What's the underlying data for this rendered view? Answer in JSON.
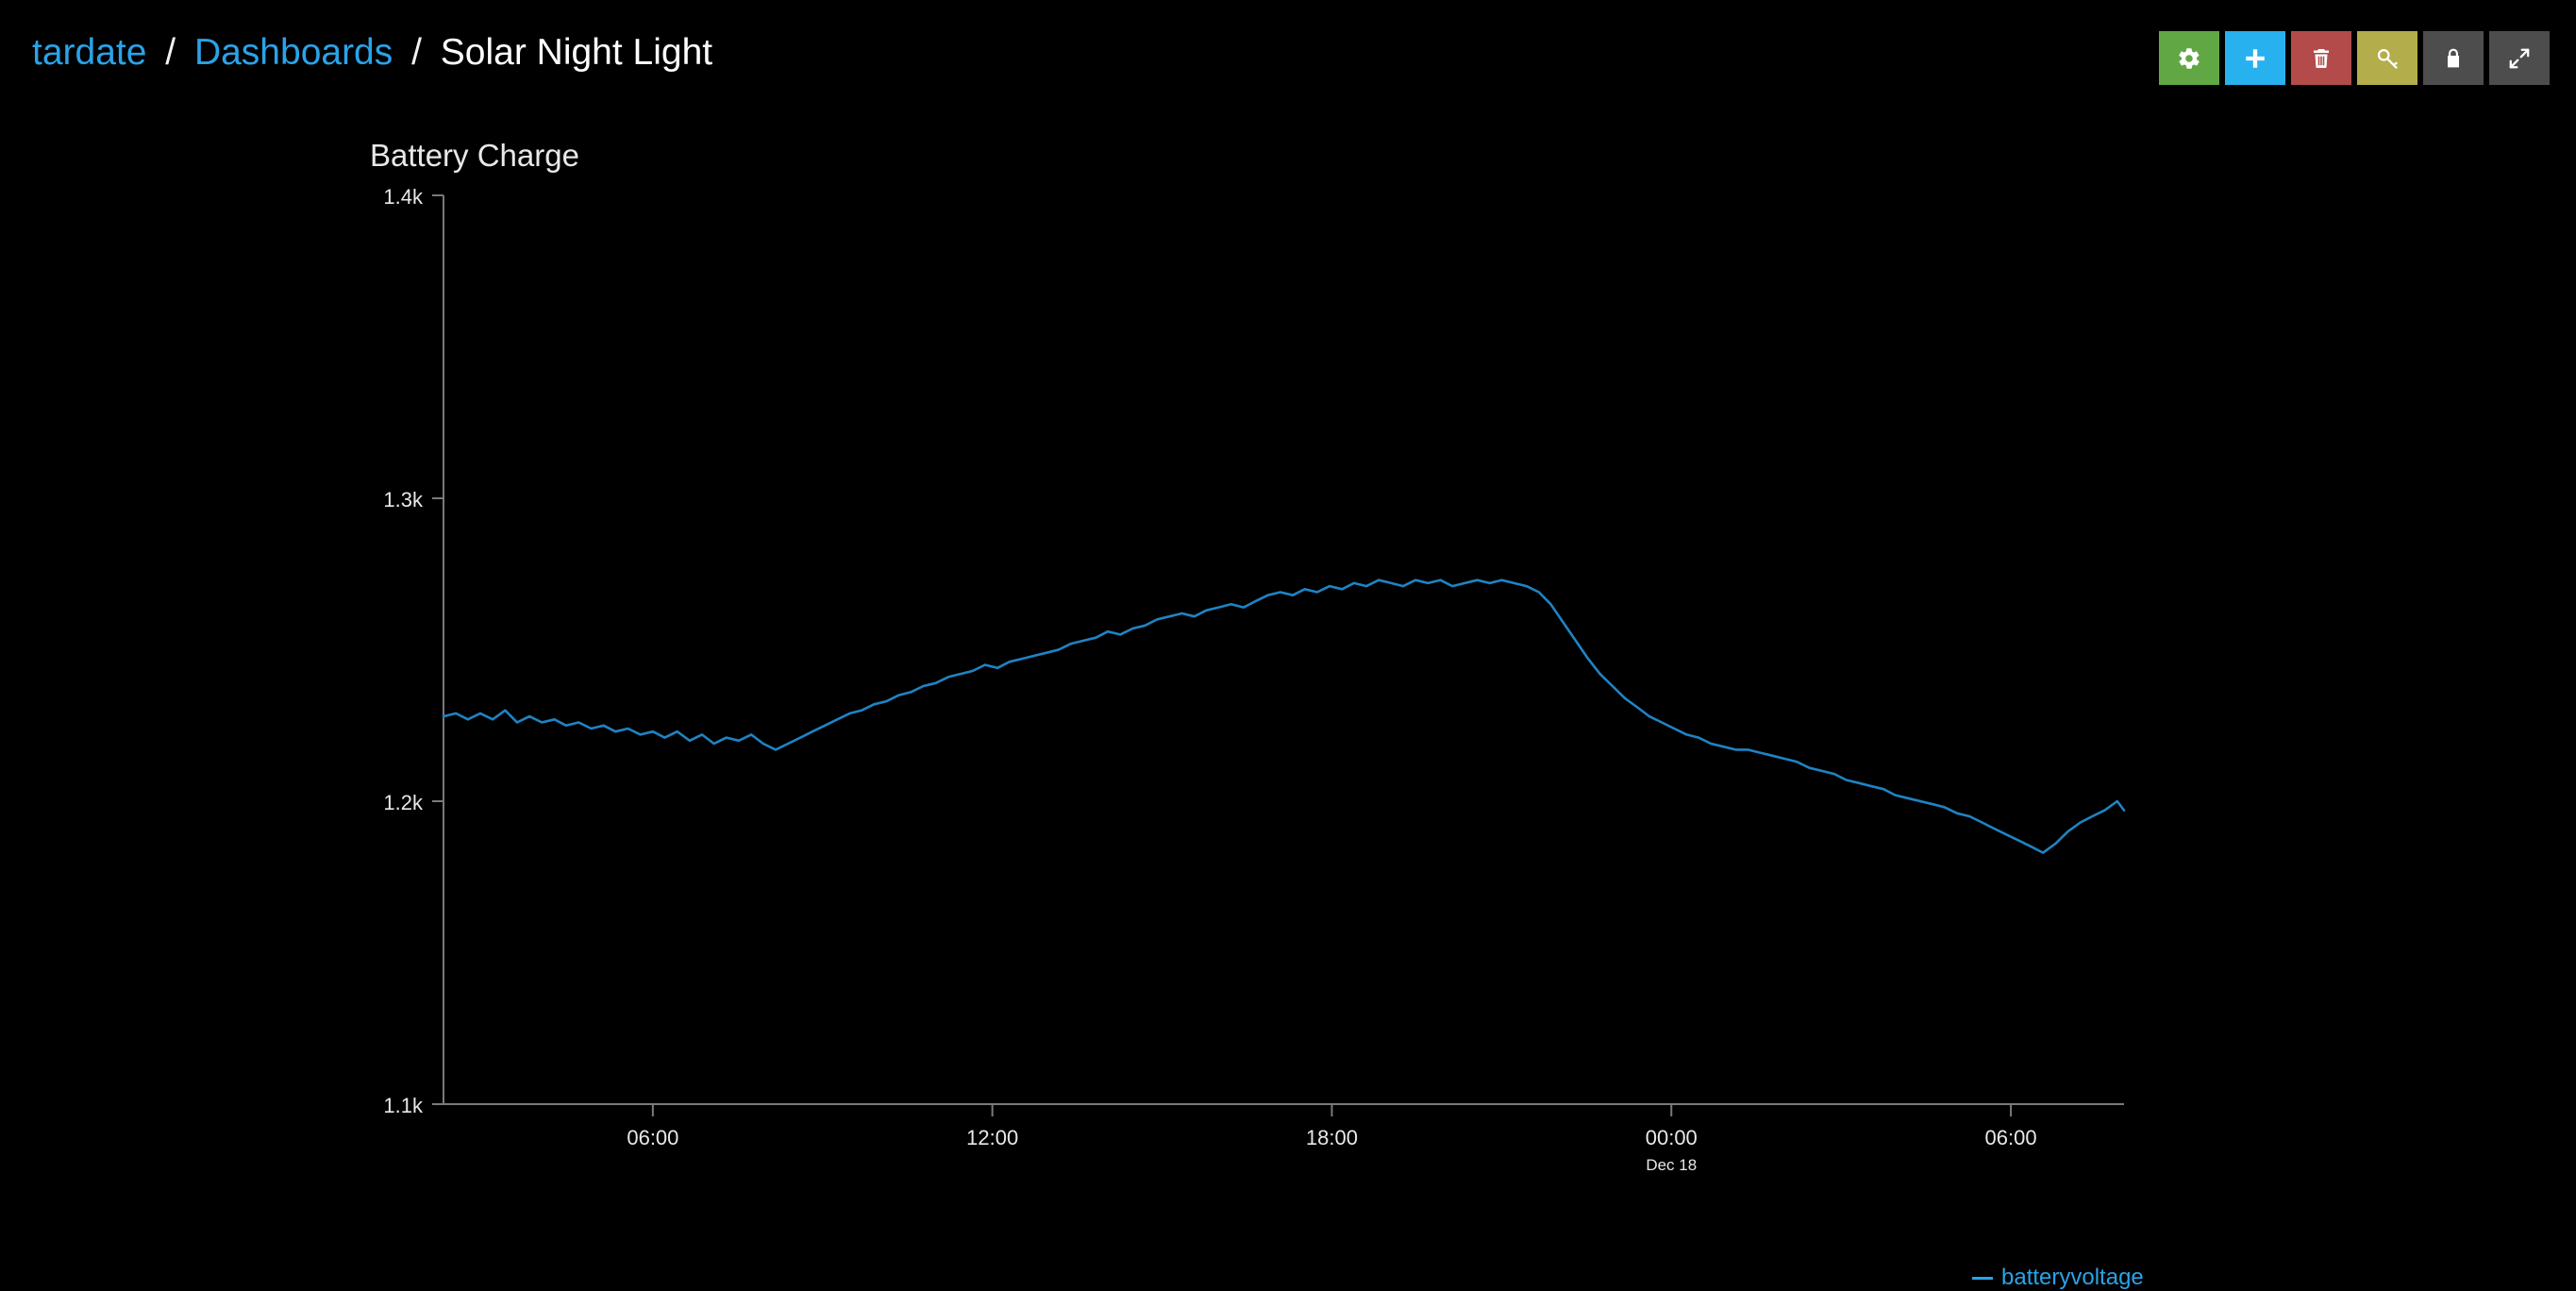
{
  "breadcrumb": {
    "separator": "/",
    "items": [
      {
        "label": "tardate",
        "type": "link"
      },
      {
        "label": "Dashboards",
        "type": "link"
      },
      {
        "label": "Solar Night Light",
        "type": "current"
      }
    ]
  },
  "toolbar": {
    "buttons": [
      {
        "name": "settings-button",
        "icon": "gear-icon",
        "label": "Settings",
        "color": "#61a844"
      },
      {
        "name": "add-button",
        "icon": "plus-icon",
        "label": "Add",
        "color": "#27b1ee"
      },
      {
        "name": "delete-button",
        "icon": "trash-icon",
        "label": "Delete",
        "color": "#b34b4b"
      },
      {
        "name": "api-key-button",
        "icon": "key-icon",
        "label": "API Key",
        "color": "#b3ae4b"
      },
      {
        "name": "lock-button",
        "icon": "lock-icon",
        "label": "Lock",
        "color": "#4d4d4d"
      },
      {
        "name": "fullscreen-button",
        "icon": "expand-arrows-icon",
        "label": "Fullscreen",
        "color": "#4d4d4d"
      }
    ]
  },
  "panel": {
    "title": "Battery Charge"
  },
  "legend": {
    "marker": "—",
    "label": "batteryvoltage",
    "color": "#2aa3e8"
  },
  "chart_data": {
    "type": "line",
    "title": "Battery Charge",
    "xlabel": "",
    "ylabel": "",
    "grid": false,
    "legend_position": "bottom-right",
    "line_color": "#1f83c4",
    "axis_color": "#7a7a7a",
    "background": "#000000",
    "ylim": [
      1100,
      1400
    ],
    "ytick_values": [
      1400,
      1300,
      1200,
      1100
    ],
    "ytick_labels": [
      "1.4k",
      "1.3k",
      "1.2k",
      "1.1k"
    ],
    "xtick_labels": [
      "06:00",
      "12:00",
      "18:00",
      "00:00",
      "06:00"
    ],
    "xtick_sublabels": [
      "",
      "",
      "",
      "Dec 18",
      ""
    ],
    "xtick_hours": [
      6,
      12,
      18,
      24,
      30
    ],
    "x_range_hours": [
      2.3,
      32.0
    ],
    "series": [
      {
        "name": "batteryvoltage",
        "color": "#1f83c4",
        "unit": "",
        "x": [
          2.3,
          2.52,
          2.73,
          2.95,
          3.17,
          3.39,
          3.6,
          3.82,
          4.04,
          4.26,
          4.47,
          4.69,
          4.91,
          5.13,
          5.34,
          5.56,
          5.78,
          6.0,
          6.21,
          6.43,
          6.65,
          6.87,
          7.08,
          7.3,
          7.52,
          7.74,
          7.95,
          8.17,
          8.39,
          8.61,
          8.82,
          9.04,
          9.26,
          9.48,
          9.69,
          9.91,
          10.13,
          10.35,
          10.56,
          10.78,
          11.0,
          11.22,
          11.43,
          11.65,
          11.87,
          12.09,
          12.3,
          12.52,
          12.74,
          12.96,
          13.17,
          13.39,
          13.61,
          13.83,
          14.04,
          14.26,
          14.48,
          14.7,
          14.91,
          15.13,
          15.35,
          15.57,
          15.78,
          16.0,
          16.22,
          16.44,
          16.65,
          16.87,
          17.09,
          17.31,
          17.52,
          17.74,
          17.96,
          18.18,
          18.39,
          18.61,
          18.83,
          19.05,
          19.26,
          19.48,
          19.7,
          19.92,
          20.13,
          20.35,
          20.57,
          20.79,
          21.0,
          21.22,
          21.44,
          21.66,
          21.87,
          22.09,
          22.31,
          22.53,
          22.74,
          22.96,
          23.18,
          23.4,
          23.61,
          23.83,
          24.05,
          24.27,
          24.48,
          24.7,
          24.92,
          25.14,
          25.35,
          25.57,
          25.79,
          26.01,
          26.22,
          26.44,
          26.66,
          26.88,
          27.09,
          27.31,
          27.53,
          27.75,
          27.96,
          28.18,
          28.4,
          28.62,
          28.83,
          29.05,
          29.27,
          29.49,
          29.7,
          29.92,
          30.14,
          30.36,
          30.57,
          30.79,
          31.01,
          31.23,
          31.44,
          31.66,
          31.88,
          32.0
        ],
        "y": [
          1228,
          1229,
          1227,
          1229,
          1227,
          1230,
          1226,
          1228,
          1226,
          1227,
          1225,
          1226,
          1224,
          1225,
          1223,
          1224,
          1222,
          1223,
          1221,
          1223,
          1220,
          1222,
          1219,
          1221,
          1220,
          1222,
          1219,
          1217,
          1219,
          1221,
          1223,
          1225,
          1227,
          1229,
          1230,
          1232,
          1233,
          1235,
          1236,
          1238,
          1239,
          1241,
          1242,
          1243,
          1245,
          1244,
          1246,
          1247,
          1248,
          1249,
          1250,
          1252,
          1253,
          1254,
          1256,
          1255,
          1257,
          1258,
          1260,
          1261,
          1262,
          1261,
          1263,
          1264,
          1265,
          1264,
          1266,
          1268,
          1269,
          1268,
          1270,
          1269,
          1271,
          1270,
          1272,
          1271,
          1273,
          1272,
          1271,
          1273,
          1272,
          1273,
          1271,
          1272,
          1273,
          1272,
          1273,
          1272,
          1271,
          1269,
          1265,
          1259,
          1253,
          1247,
          1242,
          1238,
          1234,
          1231,
          1228,
          1226,
          1224,
          1222,
          1221,
          1219,
          1218,
          1217,
          1217,
          1216,
          1215,
          1214,
          1213,
          1211,
          1210,
          1209,
          1207,
          1206,
          1205,
          1204,
          1202,
          1201,
          1200,
          1199,
          1198,
          1196,
          1195,
          1193,
          1191,
          1189,
          1187,
          1185,
          1183,
          1186,
          1190,
          1193,
          1195,
          1197,
          1200,
          1197
        ]
      }
    ]
  }
}
